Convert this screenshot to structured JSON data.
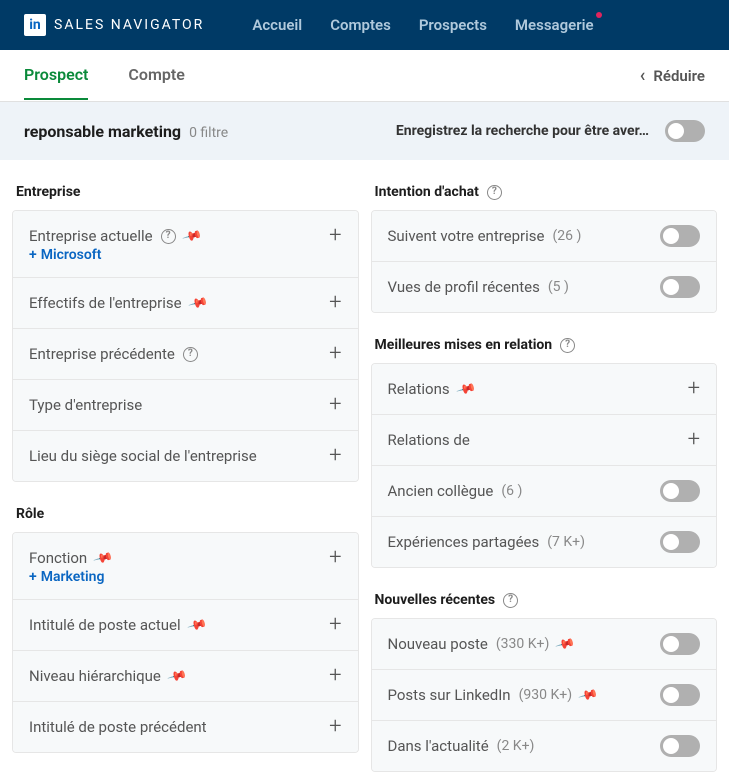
{
  "brand": "SALES NAVIGATOR",
  "nav": {
    "accueil": "Accueil",
    "comptes": "Comptes",
    "prospects": "Prospects",
    "messagerie": "Messagerie"
  },
  "tabs": {
    "prospect": "Prospect",
    "compte": "Compte",
    "reduire": "Réduire"
  },
  "search": {
    "query": "reponsable marketing",
    "filters": "0 filtre",
    "save_label": "Enregistrez la recherche pour être aver…"
  },
  "sections": {
    "entreprise": "Entreprise",
    "role": "Rôle",
    "intention": "Intention d'achat",
    "relations": "Meilleures mises en relation",
    "news": "Nouvelles récentes"
  },
  "entreprise": {
    "actuelle": "Entreprise actuelle",
    "actuelle_chip": "Microsoft",
    "effectifs": "Effectifs de l'entreprise",
    "precedente": "Entreprise précédente",
    "type": "Type d'entreprise",
    "lieu": "Lieu du siège social de l'entreprise"
  },
  "role": {
    "fonction": "Fonction",
    "fonction_chip": "Marketing",
    "poste_actuel": "Intitulé de poste actuel",
    "niveau": "Niveau hiérarchique",
    "poste_precedent": "Intitulé de poste précédent"
  },
  "intention": {
    "suivent": {
      "label": "Suivent votre entreprise",
      "count": "(26 )"
    },
    "vues": {
      "label": "Vues de profil récentes",
      "count": "(5 )"
    }
  },
  "relations": {
    "relations": "Relations",
    "relations_de": "Relations de",
    "ancien": {
      "label": "Ancien collègue",
      "count": "(6 )"
    },
    "exp": {
      "label": "Expériences partagées",
      "count": "(7 K+)"
    }
  },
  "news": {
    "nouveau": {
      "label": "Nouveau poste",
      "count": "(330 K+)"
    },
    "posts": {
      "label": "Posts sur LinkedIn",
      "count": "(930 K+)"
    },
    "actualite": {
      "label": "Dans l'actualité",
      "count": "(2 K+)"
    }
  }
}
